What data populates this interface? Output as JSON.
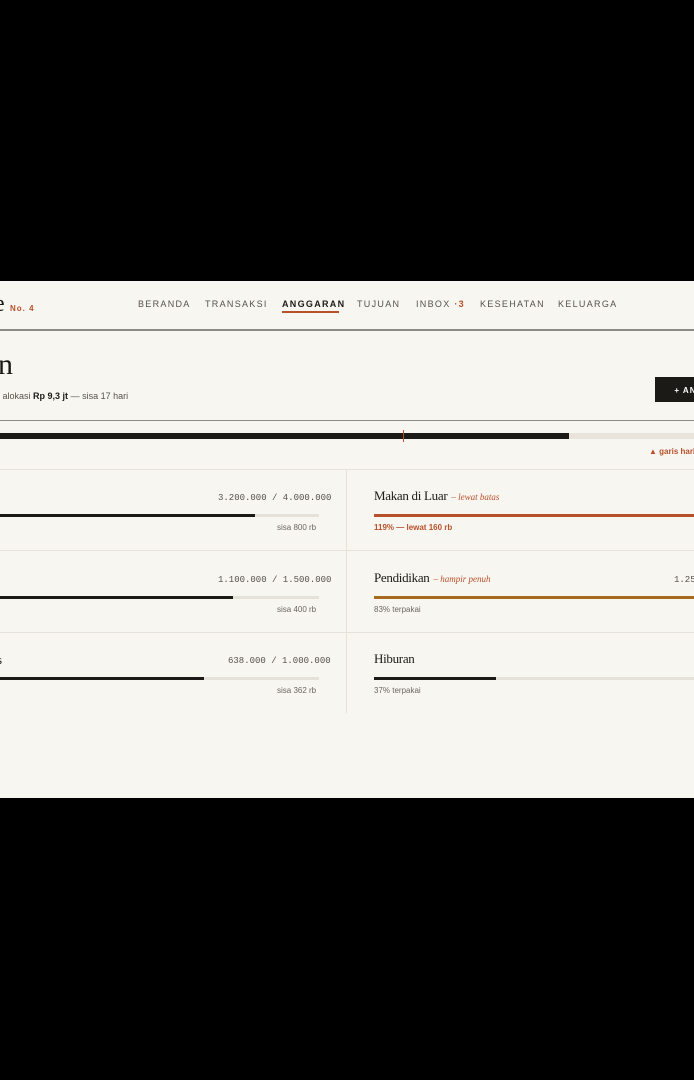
{
  "brand": {
    "logo_fragment": "e",
    "edition": "No. 4"
  },
  "nav": [
    {
      "label": "BERANDA",
      "active": false
    },
    {
      "label": "TRANSAKSI",
      "active": false
    },
    {
      "label": "ANGGARAN",
      "active": true
    },
    {
      "label": "TUJUAN",
      "active": false
    },
    {
      "label": "INBOX",
      "badge": "·3",
      "active": false
    },
    {
      "label": "KESEHATAN",
      "active": false
    },
    {
      "label": "KELUARGA",
      "active": false
    }
  ],
  "page": {
    "title_fragment": "n",
    "subtitle_prefix": "i alokasi",
    "subtitle_amount": "Rp 9,3 jt",
    "subtitle_suffix": "— sisa 17 hari",
    "add_button": "+ ANG"
  },
  "overall": {
    "fill_fraction": 0.82,
    "day_marker_fraction": 0.58,
    "marker_note": "▲ garis hari i"
  },
  "colors": {
    "accent": "#b8502a",
    "ink": "#1c1a16",
    "warning": "#a86a1f",
    "paper": "#f8f6f1"
  },
  "budgets_left": [
    {
      "name": "",
      "amount": "3.200.000 / 4.000.000",
      "fraction": 0.8,
      "foot": "sisa 800 rb"
    },
    {
      "name": "",
      "amount": "1.100.000 / 1.500.000",
      "fraction": 0.73,
      "foot": "sisa 400 rb"
    },
    {
      "name": "s",
      "amount": "638.000 / 1.000.000",
      "fraction": 0.638,
      "foot": "sisa 362 rb"
    }
  ],
  "budgets_right": [
    {
      "name": "Makan di Luar",
      "note": "– lewat batas",
      "amount": "",
      "fraction": 1.0,
      "foot": "119% — lewat 160 rb",
      "status": "over"
    },
    {
      "name": "Pendidikan",
      "note": "– hampir penuh",
      "amount": "1.25",
      "fraction": 1.0,
      "foot": "83% terpakai",
      "status": "near"
    },
    {
      "name": "Hiburan",
      "note": "",
      "amount": "",
      "fraction": 0.37,
      "foot": "37% terpakai",
      "status": "ok"
    }
  ]
}
